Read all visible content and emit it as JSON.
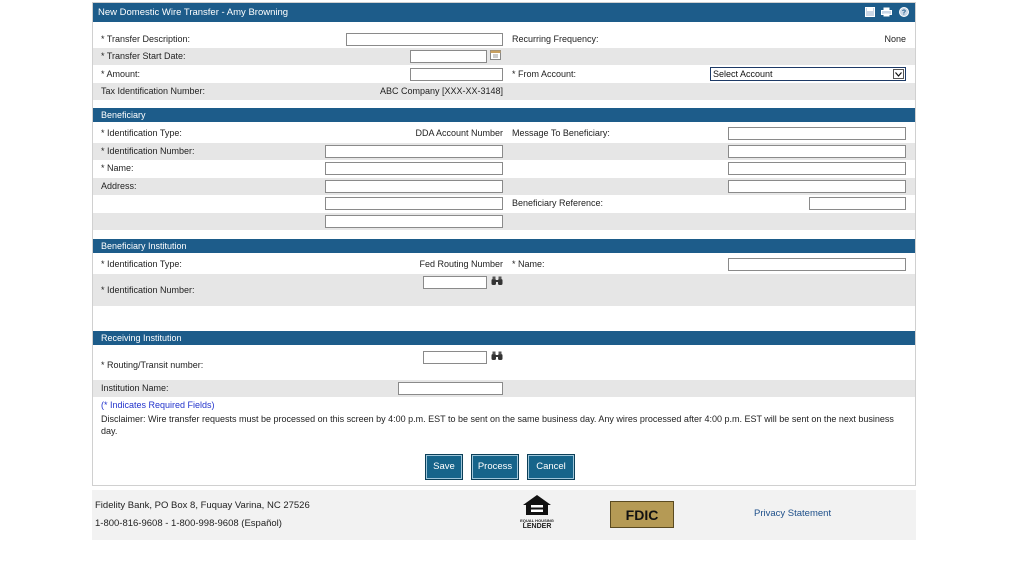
{
  "title": "New Domestic Wire Transfer - Amy Browning",
  "transfer": {
    "description_label": "* Transfer Description:",
    "recurring_label": "Recurring Frequency:",
    "recurring_value": "None",
    "start_date_label": "* Transfer Start Date:",
    "amount_label": "* Amount:",
    "from_account_label": "* From Account:",
    "from_account_value": "Select Account",
    "tax_id_label": "Tax Identification Number:",
    "tax_id_value": "ABC Company [XXX-XX-3148]"
  },
  "beneficiary": {
    "section": "Beneficiary",
    "id_type_label": "* Identification Type:",
    "id_type_value": "DDA Account Number",
    "message_label": "Message To Beneficiary:",
    "id_number_label": "* Identification Number:",
    "name_label": "* Name:",
    "address_label": "Address:",
    "reference_label": "Beneficiary Reference:"
  },
  "beneficiary_institution": {
    "section": "Beneficiary Institution",
    "id_type_label": "* Identification Type:",
    "id_type_value": "Fed Routing Number",
    "name_label": "* Name:",
    "id_number_label": "* Identification Number:"
  },
  "receiving_institution": {
    "section": "Receiving Institution",
    "routing_label": "* Routing/Transit number:",
    "institution_name_label": "Institution Name:"
  },
  "required_note": "(* Indicates Required Fields)",
  "disclaimer": "Disclaimer: Wire transfer requests must be processed on this screen by 4:00 p.m. EST to be sent on the same business day. Any wires processed after 4:00 p.m. EST will be sent on the next business day.",
  "buttons": {
    "save": "Save",
    "process": "Process",
    "cancel": "Cancel"
  },
  "footer": {
    "address": "Fidelity Bank, PO Box 8, Fuquay Varina, NC 27526",
    "phones": "1-800-816-9608 - 1-800-998-9608 (Español)",
    "ehl_line1": "EQUAL HOUSING",
    "ehl_line2": "LENDER",
    "fdic": "FDIC",
    "privacy": "Privacy Statement"
  },
  "colors": {
    "header_blue": "#1d5c8a",
    "button_blue": "#16648a",
    "row_gray": "#e6e6e6",
    "link_blue": "#2233cc"
  },
  "icons": [
    "save-icon",
    "print-icon",
    "help-icon",
    "calendar-icon",
    "binoculars-icon",
    "chevron-down-icon",
    "equal-housing-icon"
  ]
}
